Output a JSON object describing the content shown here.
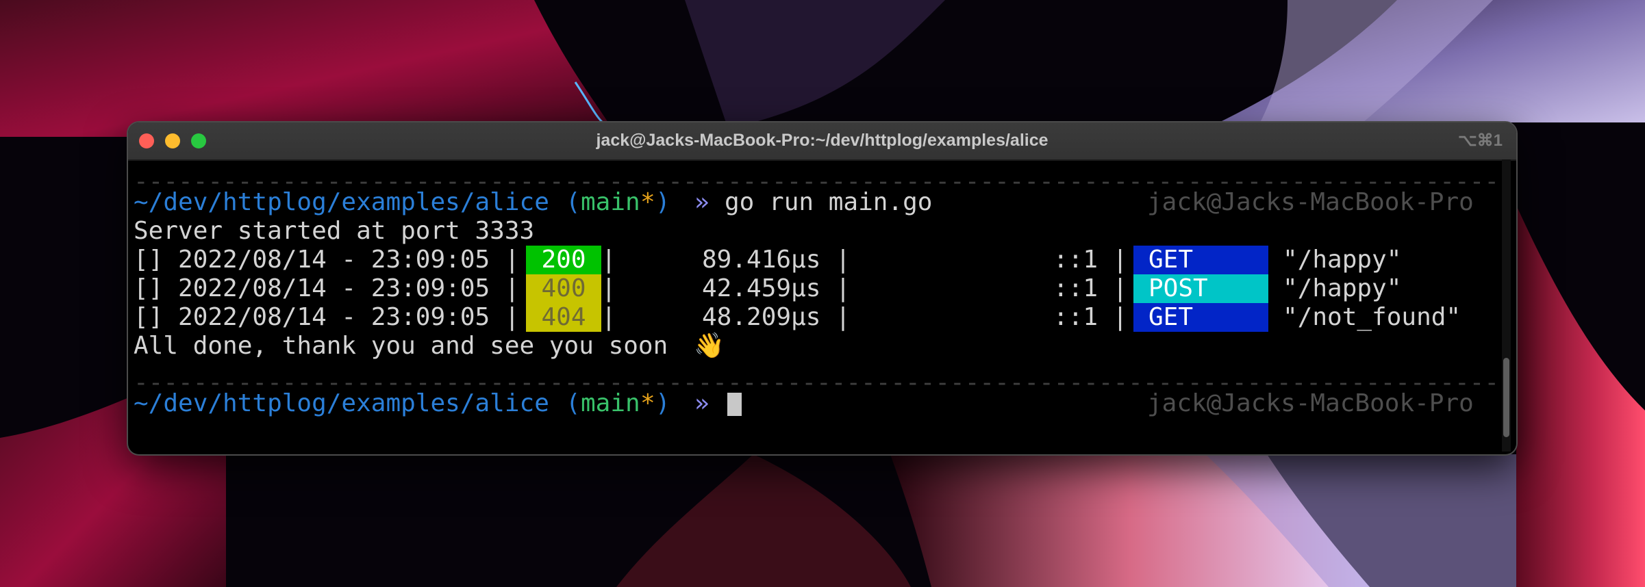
{
  "window": {
    "title": "jack@Jacks-MacBook-Pro:~/dev/httplog/examples/alice",
    "shortcut": "⌥⌘1"
  },
  "colors": {
    "status_200_bg": "#00c200",
    "status_4xx_bg": "#c7c400",
    "method_get_bg": "#0225c7",
    "method_post_bg": "#00c5c7",
    "path_blue": "#2b7fd8",
    "branch_green": "#39c26a"
  },
  "terminal": {
    "separator": "--------------------------------------------------------------------------------------------------------------------------------------------------",
    "prompt": {
      "path": "~/dev/httplog/examples/alice",
      "paren_open": "(",
      "branch": "main",
      "dirty_mark": "*",
      "paren_close": ")",
      "arrow": "»",
      "right_prompt": "jack@Jacks-MacBook-Pro"
    },
    "command": "go run main.go",
    "server_line": "Server started at port 3333",
    "log_rows": [
      {
        "prefix": "[] 2022/08/14 - 23:09:05 |",
        "status": "200",
        "status_kind": "ok",
        "bar": "|",
        "latency": "89.416µs |",
        "ip": "::1 |",
        "method": "GET",
        "path": "\"/happy\""
      },
      {
        "prefix": "[] 2022/08/14 - 23:09:05 |",
        "status": "400",
        "status_kind": "client-error",
        "bar": "|",
        "latency": "42.459µs |",
        "ip": "::1 |",
        "method": "POST",
        "path": "\"/happy\""
      },
      {
        "prefix": "[] 2022/08/14 - 23:09:05 |",
        "status": "404",
        "status_kind": "client-error",
        "bar": "|",
        "latency": "48.209µs |",
        "ip": "::1 |",
        "method": "GET",
        "path": "\"/not_found\""
      }
    ],
    "done_line": "All done, thank you and see you soon",
    "done_emoji": "👋"
  }
}
